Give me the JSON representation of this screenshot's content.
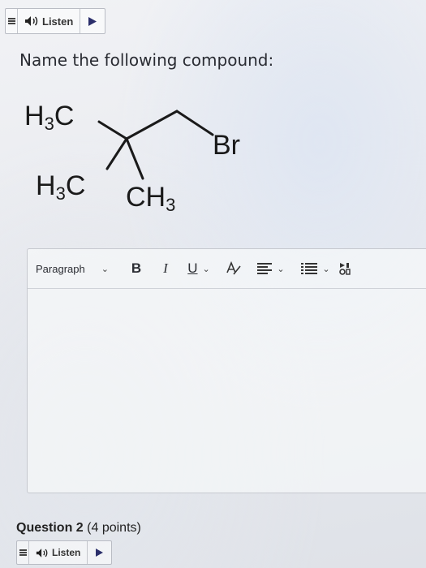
{
  "listen_bar_top": {
    "label": "Listen"
  },
  "question": {
    "prompt": "Name the following compound:",
    "structure_labels": {
      "methyl_upper": "H3C",
      "methyl_lower": "H3C",
      "methyl_right": "CH3",
      "bromine": "Br"
    }
  },
  "editor": {
    "block_format": "Paragraph",
    "bold_label": "B",
    "italic_label": "I",
    "underline_label": "U",
    "icons": [
      "format-text-icon",
      "align-icon",
      "list-icon",
      "more-icon"
    ],
    "content": ""
  },
  "question2": {
    "title": "Question 2",
    "points": "(4 points)"
  },
  "listen_bar_bottom": {
    "label": "Listen"
  }
}
